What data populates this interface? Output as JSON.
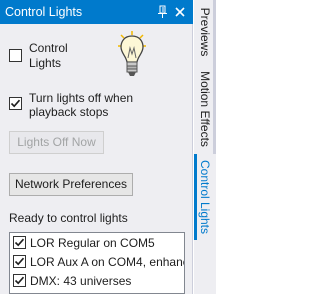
{
  "window": {
    "title": "Control Lights"
  },
  "controls": {
    "control_lights_label_line1": "Control",
    "control_lights_label_line2": "Lights",
    "control_lights_checked": false,
    "turn_off_label_line1": "Turn lights off when",
    "turn_off_label_line2": "playback stops",
    "turn_off_checked": true,
    "lights_off_button": "Lights Off Now",
    "network_prefs_button": "Network Preferences",
    "ready_label": "Ready to control lights"
  },
  "networks": [
    {
      "label": "LOR Regular on COM5",
      "checked": true
    },
    {
      "label": "LOR Aux A on COM4, enhanc",
      "checked": true
    },
    {
      "label": "DMX: 43 universes",
      "checked": true
    }
  ],
  "tabs": [
    {
      "label": "Previews",
      "active": false
    },
    {
      "label": "Motion Effects",
      "active": false
    },
    {
      "label": "Control Lights",
      "active": true
    }
  ],
  "icons": {
    "pin": "pin-icon",
    "close": "close-icon",
    "bulb": "light-bulb-icon",
    "checkmark": "checkmark-icon"
  },
  "colors": {
    "accent": "#007acc",
    "panel_bg": "#eeeef2"
  }
}
